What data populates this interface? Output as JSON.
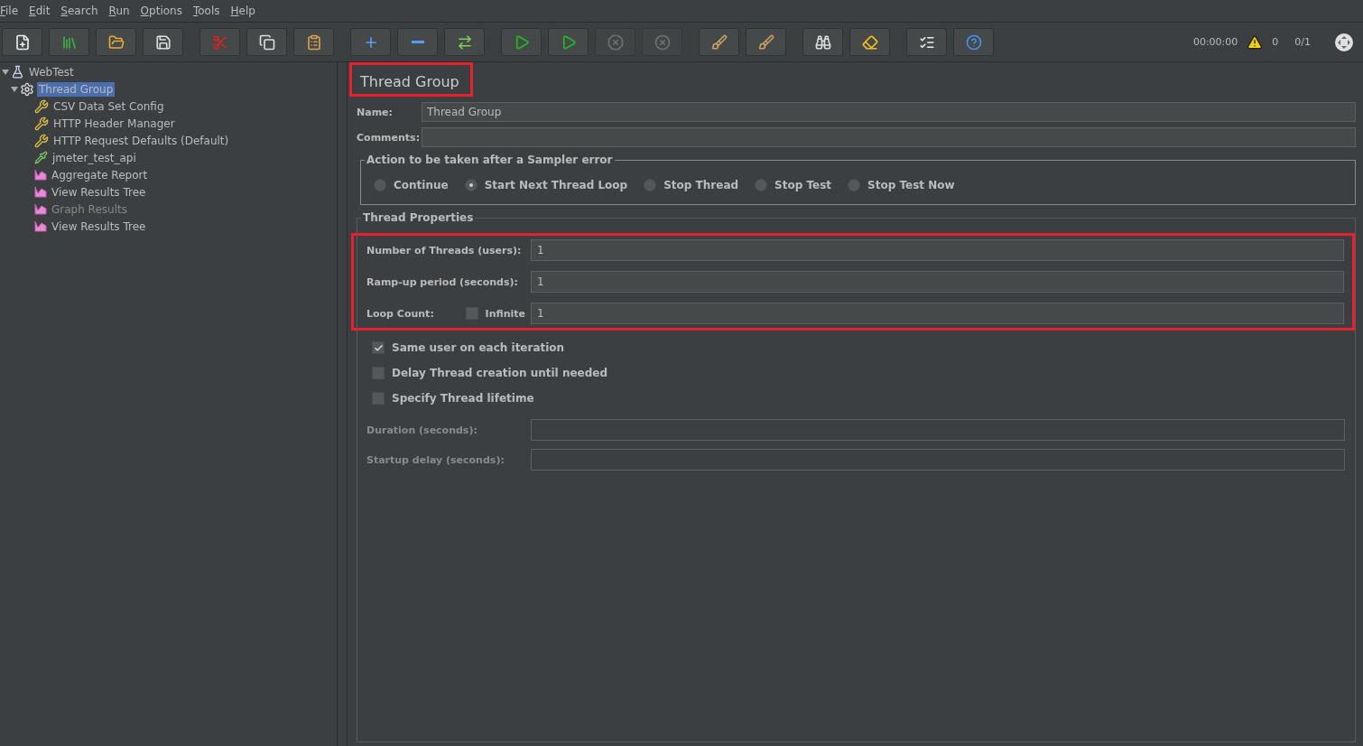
{
  "menu": [
    {
      "label": "File"
    },
    {
      "label": "Edit"
    },
    {
      "label": "Search"
    },
    {
      "label": "Run"
    },
    {
      "label": "Options"
    },
    {
      "label": "Tools"
    },
    {
      "label": "Help"
    }
  ],
  "toolbar": [
    [
      {
        "kind": "new",
        "disabled": false
      },
      {
        "kind": "templates",
        "disabled": false
      },
      {
        "kind": "open",
        "disabled": false
      },
      {
        "kind": "save",
        "disabled": false
      }
    ],
    [
      {
        "kind": "cut",
        "disabled": false
      },
      {
        "kind": "copy",
        "disabled": false
      },
      {
        "kind": "paste",
        "disabled": false
      }
    ],
    [
      {
        "kind": "expand",
        "disabled": false
      },
      {
        "kind": "collapse",
        "disabled": false
      },
      {
        "kind": "toggle",
        "disabled": false
      }
    ],
    [
      {
        "kind": "start",
        "disabled": false
      },
      {
        "kind": "start-no-pause",
        "disabled": false
      },
      {
        "kind": "stop",
        "disabled": true
      },
      {
        "kind": "shutdown",
        "disabled": true
      }
    ],
    [
      {
        "kind": "clear",
        "disabled": false
      },
      {
        "kind": "clear-all",
        "disabled": false
      }
    ],
    [
      {
        "kind": "search",
        "disabled": false
      },
      {
        "kind": "reset-search",
        "disabled": false
      }
    ],
    [
      {
        "kind": "functions",
        "disabled": false
      },
      {
        "kind": "help",
        "disabled": false
      }
    ]
  ],
  "status": {
    "timer": "00:00:00",
    "warnings": "0",
    "threads": "0/1"
  },
  "tree": [
    {
      "label": "WebTest",
      "kind": "plan",
      "selected": false,
      "disabled": false,
      "expanded": true,
      "children": [
        {
          "label": "Thread Group",
          "kind": "thread-group",
          "selected": true,
          "disabled": false,
          "expanded": true,
          "children": [
            {
              "label": "CSV Data Set Config",
              "kind": "config",
              "selected": false,
              "disabled": false
            },
            {
              "label": "HTTP Header Manager",
              "kind": "config",
              "selected": false,
              "disabled": false
            },
            {
              "label": "HTTP Request Defaults (Default)",
              "kind": "config",
              "selected": false,
              "disabled": false
            },
            {
              "label": "jmeter_test_api",
              "kind": "sampler",
              "selected": false,
              "disabled": false
            },
            {
              "label": "Aggregate Report",
              "kind": "listener",
              "selected": false,
              "disabled": false
            },
            {
              "label": "View Results Tree",
              "kind": "listener",
              "selected": false,
              "disabled": false
            },
            {
              "label": "Graph Results",
              "kind": "listener",
              "selected": false,
              "disabled": true
            },
            {
              "label": "View Results Tree",
              "kind": "listener",
              "selected": false,
              "disabled": false
            }
          ]
        }
      ]
    }
  ],
  "panel": {
    "title": "Thread Group",
    "title_highlighted": true,
    "name": {
      "label": "Name:",
      "value": "Thread Group"
    },
    "comments": {
      "label": "Comments:"
    },
    "error_action": {
      "title": "Action to be taken after a Sampler error",
      "options": [
        {
          "label": "Continue",
          "selected": false
        },
        {
          "label": "Start Next Thread Loop",
          "selected": true
        },
        {
          "label": "Stop Thread",
          "selected": false
        },
        {
          "label": "Stop Test",
          "selected": false
        },
        {
          "label": "Stop Test Now",
          "selected": false
        }
      ]
    },
    "thread_properties": {
      "title": "Thread Properties",
      "highlighted": true,
      "threads": {
        "label": "Number of Threads (users):",
        "value": "1"
      },
      "ramp_up": {
        "label": "Ramp-up period (seconds):",
        "value": "1"
      },
      "loop": {
        "label": "Loop Count:",
        "infinite": {
          "label": "Infinite",
          "checked": false
        },
        "value": "1"
      },
      "options": [
        {
          "label": "Same user on each iteration",
          "checked": true
        },
        {
          "label": "Delay Thread creation until needed",
          "checked": false
        },
        {
          "label": "Specify Thread lifetime",
          "checked": false
        }
      ],
      "lifetime": [
        {
          "label": "Duration (seconds):",
          "disabled": true
        },
        {
          "label": "Startup delay (seconds):",
          "disabled": true
        }
      ]
    }
  }
}
